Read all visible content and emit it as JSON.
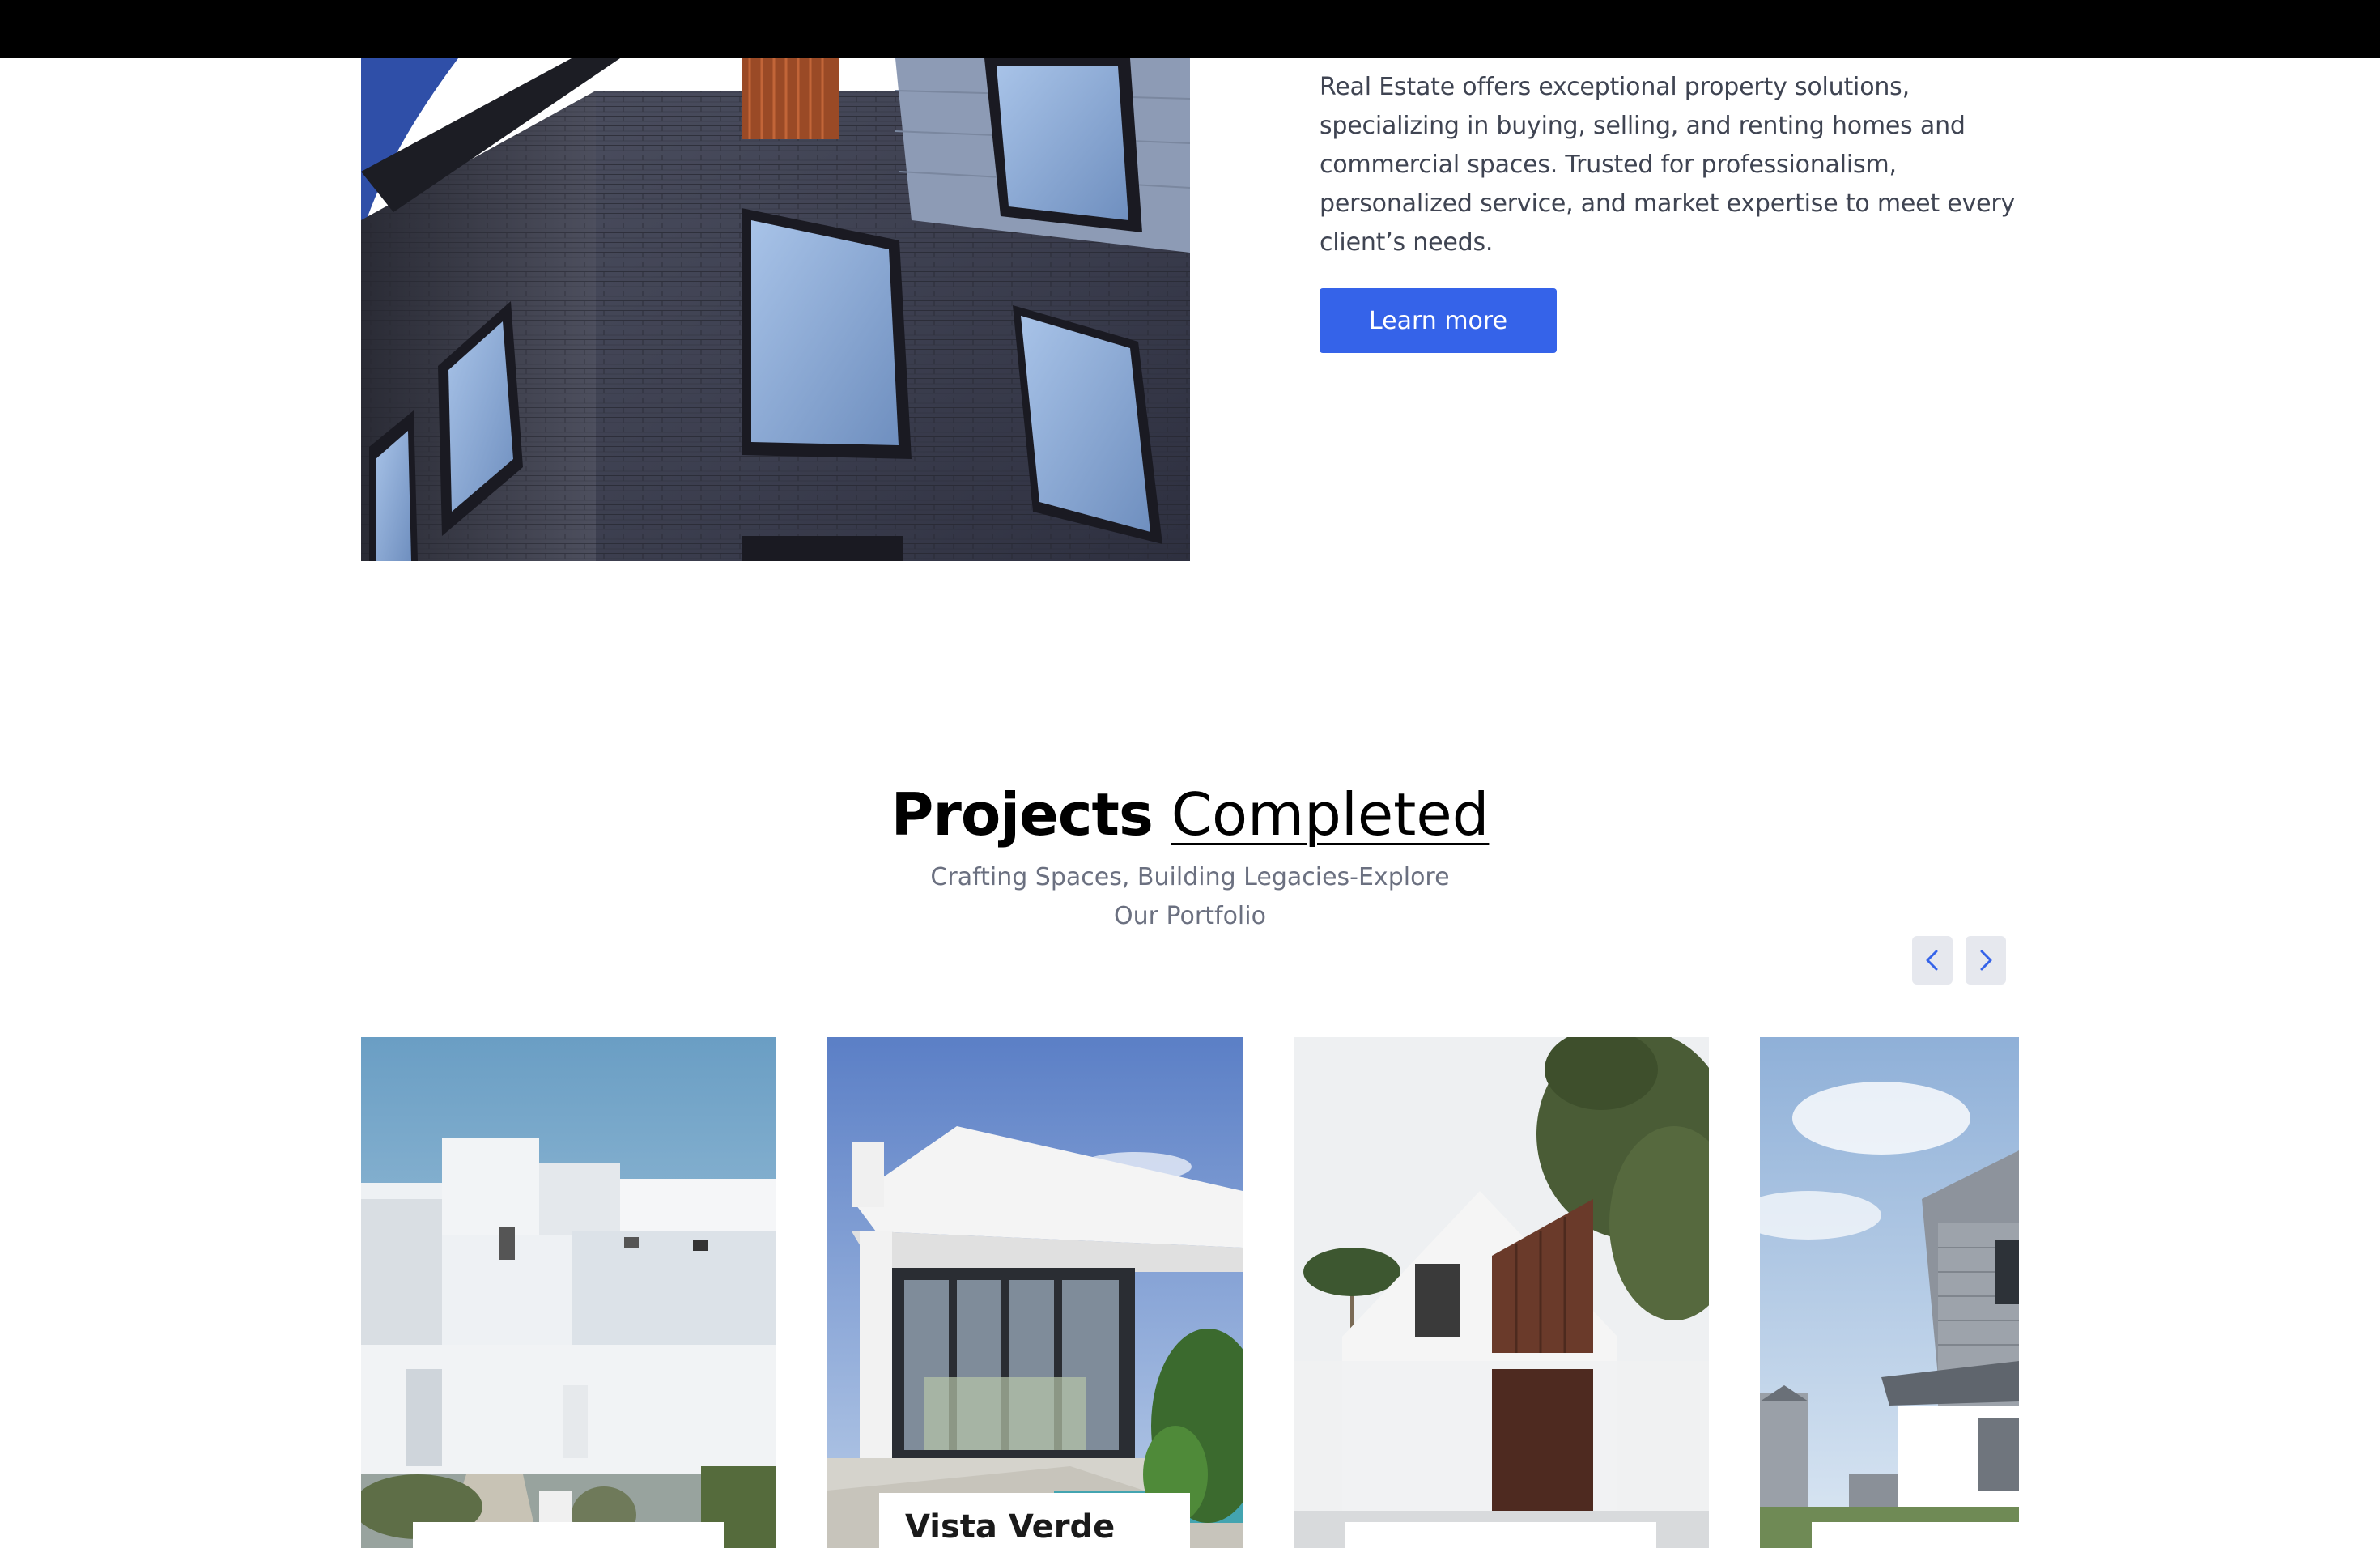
{
  "about": {
    "description": "Real Estate offers exceptional property solutions, specializing in buying, selling, and renting homes and commercial spaces. Trusted for professionalism, personalized service, and market expertise to meet every client’s needs.",
    "learn_more_label": "Learn more"
  },
  "projects": {
    "title_bold": "Projects",
    "title_light": "Completed",
    "subtitle_line1": "Crafting Spaces, Building Legacies-Explore",
    "subtitle_line2": "Our Portfolio",
    "prev_icon": "chevron-left-icon",
    "next_icon": "chevron-right-icon",
    "cards": [
      {
        "name": ""
      },
      {
        "name": "Vista Verde"
      },
      {
        "name": ""
      },
      {
        "name": ""
      }
    ]
  },
  "colors": {
    "accent": "#3563e9",
    "topbar": "#000000",
    "nav_button_bg": "#e6e8ee"
  }
}
